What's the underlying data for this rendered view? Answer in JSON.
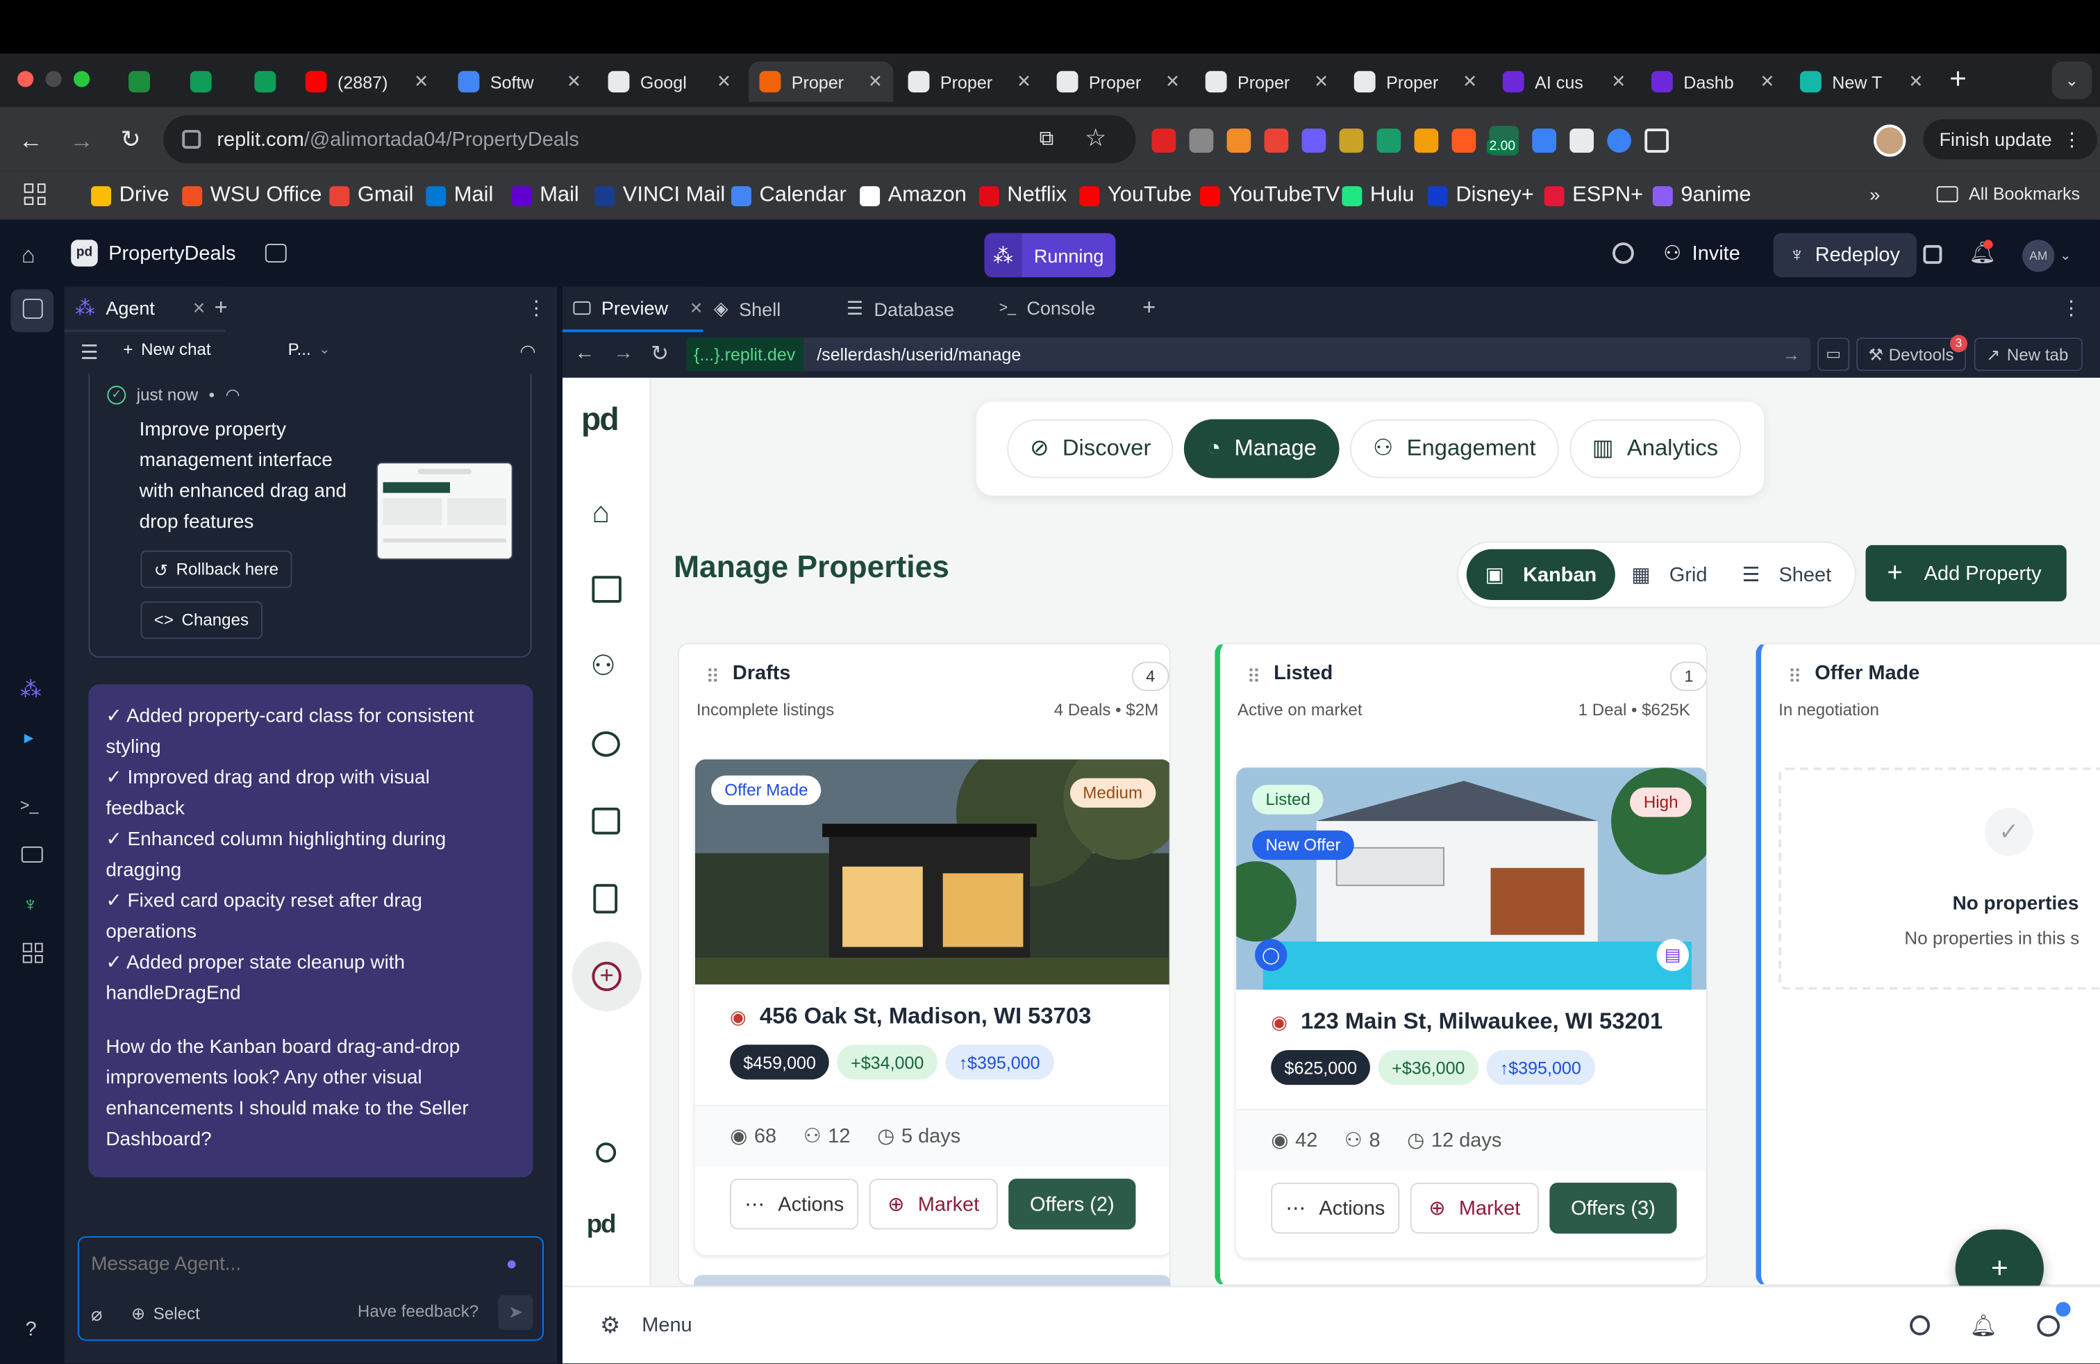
{
  "browser": {
    "tabs": [
      {
        "label": "",
        "color": "#1e8e3e"
      },
      {
        "label": "",
        "color": "#0f9d58"
      },
      {
        "label": "",
        "color": "#0f9d58"
      },
      {
        "label": "(2887)",
        "color": "#ff0000"
      },
      {
        "label": "Softw",
        "color": "#4285f4"
      },
      {
        "label": "Googl",
        "color": "#e8eaed"
      },
      {
        "label": "Proper",
        "color": "#f26207"
      },
      {
        "label": "Proper",
        "color": "#e8eaed"
      },
      {
        "label": "Proper",
        "color": "#e8eaed"
      },
      {
        "label": "Proper",
        "color": "#e8eaed"
      },
      {
        "label": "Proper",
        "color": "#e8eaed"
      },
      {
        "label": "AI cus",
        "color": "#6d28d9"
      },
      {
        "label": "Dashb",
        "color": "#6d28d9"
      },
      {
        "label": "New T",
        "color": "#14b8a6"
      }
    ],
    "url_host": "replit.com",
    "url_path": "/@alimortada04/PropertyDeals",
    "finish_update": "Finish update",
    "ext_badge": "2.00",
    "bookmarks": [
      {
        "label": "Drive",
        "color": "#fbbc04"
      },
      {
        "label": "WSU Office",
        "color": "#f25022"
      },
      {
        "label": "Gmail",
        "color": "#ea4335"
      },
      {
        "label": "Mail",
        "color": "#0078d4"
      },
      {
        "label": "Mail",
        "color": "#6001d2"
      },
      {
        "label": "VINCI Mail",
        "color": "#1a3c8f"
      },
      {
        "label": "Calendar",
        "color": "#4285f4"
      },
      {
        "label": "Amazon",
        "color": "#ffffff"
      },
      {
        "label": "Netflix",
        "color": "#e50914"
      },
      {
        "label": "YouTube",
        "color": "#ff0000"
      },
      {
        "label": "YouTubeTV",
        "color": "#ff0000"
      },
      {
        "label": "Hulu",
        "color": "#1ce783"
      },
      {
        "label": "Disney+",
        "color": "#113ccf"
      },
      {
        "label": "ESPN+",
        "color": "#e31937"
      },
      {
        "label": "9anime",
        "color": "#8b5cf6"
      }
    ],
    "all_bookmarks": "All Bookmarks"
  },
  "replit": {
    "project_name": "PropertyDeals",
    "run_status": "Running",
    "invite": "Invite",
    "redeploy": "Redeploy",
    "avatar_initials": "AM",
    "agent_tab": "Agent",
    "new_chat": "New chat",
    "model_select": "P...",
    "checkpoint_time": "just now",
    "checkpoint_text": "Improve property management interface with enhanced drag and drop features",
    "rollback": "Rollback here",
    "changes": "Changes",
    "agent_message": [
      "✓ Added property-card class for consistent styling",
      "✓ Improved drag and drop with visual feedback",
      "✓ Enhanced column highlighting during dragging",
      "✓ Fixed card opacity reset after drag operations",
      "✓ Added proper state cleanup with handleDragEnd"
    ],
    "agent_question": "How do the Kanban board drag-and-drop improvements look? Any other visual enhancements I should make to the Seller Dashboard?",
    "input_placeholder": "Message Agent...",
    "select": "Select",
    "feedback": "Have feedback?",
    "pane_tabs": [
      "Preview",
      "Shell",
      "Database",
      "Console"
    ],
    "preview_domain": "{...}.replit.dev",
    "preview_path": "/sellerdash/userid/manage",
    "devtools": "Devtools",
    "devtools_badge": "3",
    "new_tab": "New tab",
    "menu": "Menu"
  },
  "app": {
    "logo": "pd",
    "nav": [
      "Discover",
      "Manage",
      "Engagement",
      "Analytics"
    ],
    "title": "Manage Properties",
    "views": [
      "Kanban",
      "Grid",
      "Sheet"
    ],
    "add_property": "Add Property",
    "columns": [
      {
        "name": "Drafts",
        "count": "4",
        "subtitle": "Incomplete listings",
        "summary": "4 Deals • $2M",
        "accent": "#e5e7eb",
        "card": {
          "status_tag": "Offer Made",
          "priority": "Medium",
          "address": "456 Oak St, Madison, WI 53703",
          "price": "$459,000",
          "delta": "+$34,000",
          "offer": "↑$395,000",
          "views": "68",
          "people": "12",
          "days": "5 days",
          "actions": "Actions",
          "market": "Market",
          "offers": "Offers (2)"
        }
      },
      {
        "name": "Listed",
        "count": "1",
        "subtitle": "Active on market",
        "summary": "1 Deal • $625K",
        "accent": "#22c55e",
        "card": {
          "status_tag": "Listed",
          "new_offer": "New Offer",
          "priority": "High",
          "address": "123 Main St, Milwaukee, WI 53201",
          "price": "$625,000",
          "delta": "+$36,000",
          "offer": "↑$395,000",
          "views": "42",
          "people": "8",
          "days": "12 days",
          "actions": "Actions",
          "market": "Market",
          "offers": "Offers (3)"
        }
      },
      {
        "name": "Offer Made",
        "subtitle": "In negotiation",
        "accent": "#3b82f6",
        "empty_title": "No properties",
        "empty_text": "No properties in this s"
      }
    ]
  }
}
